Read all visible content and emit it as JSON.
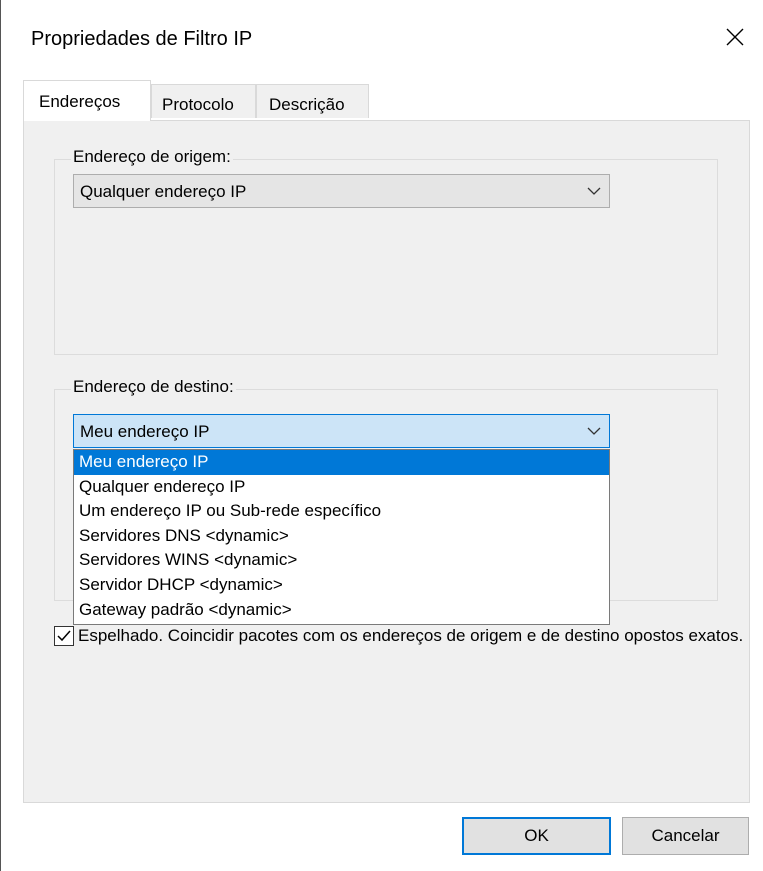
{
  "window": {
    "title": "Propriedades de Filtro IP"
  },
  "tabs": [
    {
      "label": "Endereços"
    },
    {
      "label": "Protocolo"
    },
    {
      "label": "Descrição"
    }
  ],
  "source": {
    "label": "Endereço de origem:",
    "selected": "Qualquer endereço IP"
  },
  "destination": {
    "label": "Endereço de destino:",
    "selected": "Meu endereço IP",
    "options": [
      "Meu endereço IP",
      "Qualquer endereço IP",
      "Um endereço IP ou Sub-rede específico",
      "Servidores DNS <dynamic>",
      "Servidores WINS <dynamic>",
      "Servidor DHCP <dynamic>",
      "Gateway padrão <dynamic>"
    ]
  },
  "mirrored": {
    "checked": true,
    "label": "Espelhado. Coincidir pacotes com os endereços de origem e de destino opostos exatos."
  },
  "buttons": {
    "ok": "OK",
    "cancel": "Cancelar"
  },
  "colors": {
    "accent": "#0078d7",
    "panel": "#f0f0f0",
    "selected_text": "#ffffff"
  }
}
